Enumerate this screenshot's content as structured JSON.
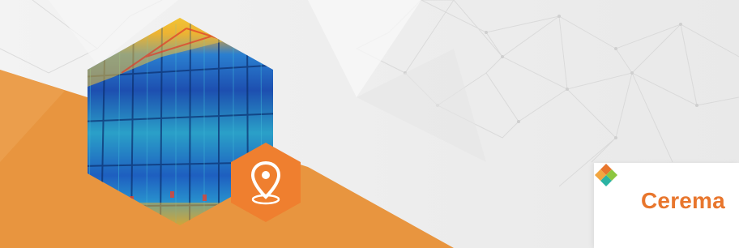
{
  "banner": {
    "photo": "thermal-infrared-building-facade",
    "badge_icon": "location-pin-icon"
  },
  "logo": {
    "name": "Cerema",
    "mark_icon": "cerema-diamond-icon"
  },
  "colors": {
    "accent_orange": "#e8953f",
    "badge_orange": "#ef7f2f",
    "logo_orange": "#e8762d",
    "logo_teal": "#2bb3a3",
    "logo_green": "#8cc63f",
    "background": "#efefef"
  }
}
